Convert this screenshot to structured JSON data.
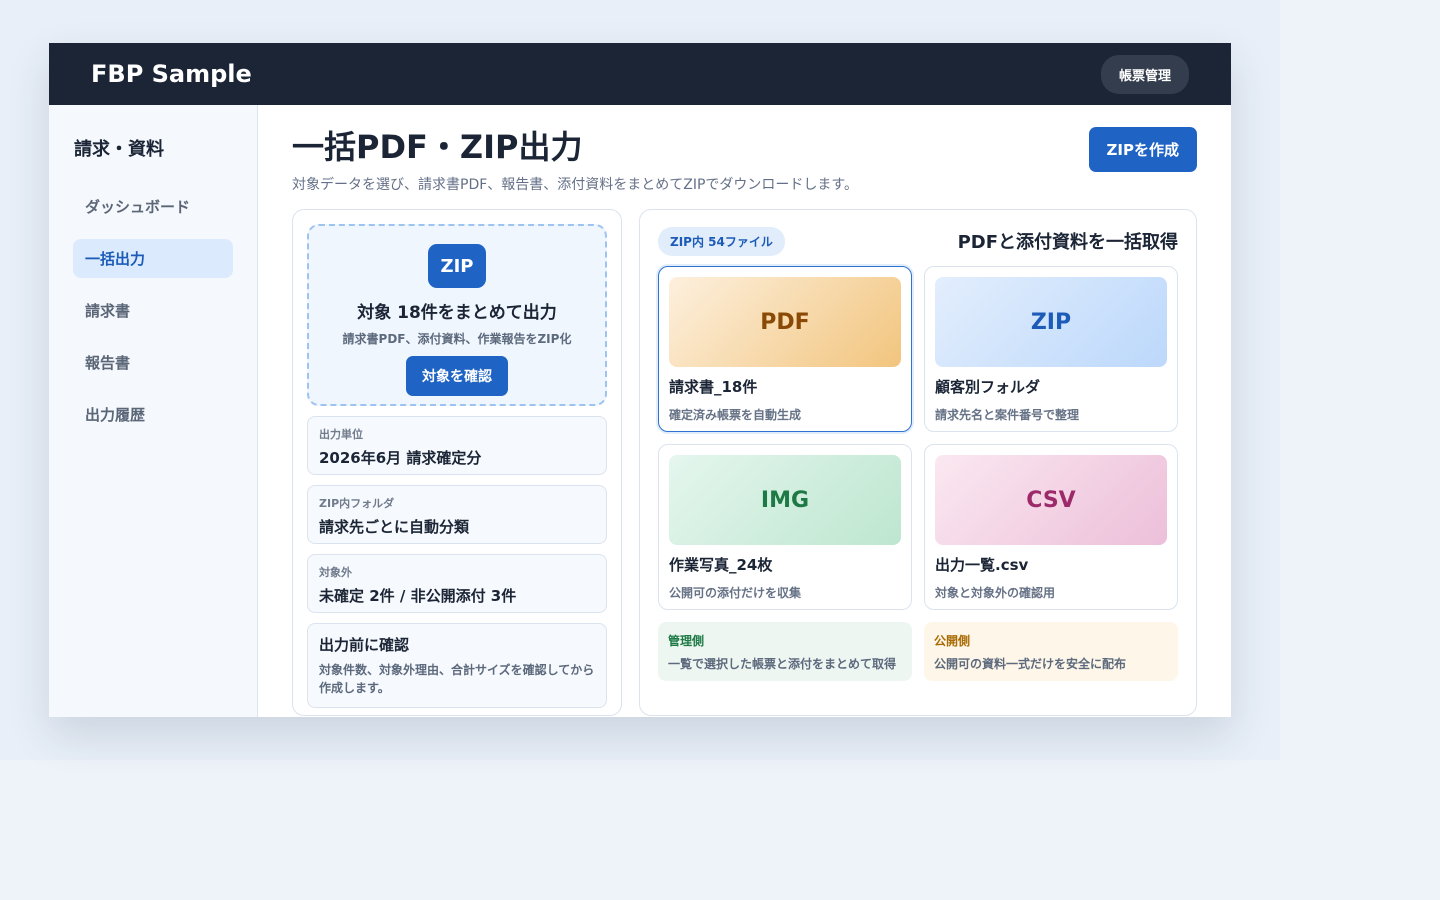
{
  "app": {
    "brand": "FBP Sample",
    "top_button": "帳票管理"
  },
  "sidebar": {
    "title": "請求・資料",
    "items": [
      {
        "label": "ダッシュボード",
        "active": false
      },
      {
        "label": "一括出力",
        "active": true
      },
      {
        "label": "請求書",
        "active": false
      },
      {
        "label": "報告書",
        "active": false
      },
      {
        "label": "出力履歴",
        "active": false
      }
    ]
  },
  "page": {
    "title": "一括PDF・ZIP出力",
    "subtitle": "対象データを選び、請求書PDF、報告書、添付資料をまとめてZIPでダウンロードします。",
    "primary_button": "ZIPを作成"
  },
  "dropzone": {
    "badge": "ZIP",
    "title": "対象 18件をまとめて出力",
    "subtitle": "請求書PDF、添付資料、作業報告をZIP化",
    "button": "対象を確認"
  },
  "info": [
    {
      "label": "出力単位",
      "value": "2026年6月 請求確定分"
    },
    {
      "label": "ZIP内フォルダ",
      "value": "請求先ごとに自動分類"
    },
    {
      "label": "対象外",
      "value": "未確定 2件 / 非公開添付 3件"
    }
  ],
  "note": {
    "title": "出力前に確認",
    "text": "対象件数、対象外理由、合計サイズを確認してから作成します。"
  },
  "right": {
    "pill": "ZIP内 54ファイル",
    "title": "PDFと添付資料を一括取得",
    "files": [
      {
        "thumb": "PDF",
        "name": "請求書_18件",
        "desc": "確定済み帳票を自動生成"
      },
      {
        "thumb": "ZIP",
        "name": "顧客別フォルダ",
        "desc": "請求先名と案件番号で整理"
      },
      {
        "thumb": "IMG",
        "name": "作業写真_24枚",
        "desc": "公開可の添付だけを収集"
      },
      {
        "thumb": "CSV",
        "name": "出力一覧.csv",
        "desc": "対象と対象外の確認用"
      }
    ],
    "roles": [
      {
        "label": "管理側",
        "text": "一覧で選択した帳票と添付をまとめて取得"
      },
      {
        "label": "公開側",
        "text": "公開可の資料一式だけを安全に配布"
      }
    ]
  },
  "colors": {
    "accent": "#1f63c4",
    "topbar": "#1c2535"
  }
}
